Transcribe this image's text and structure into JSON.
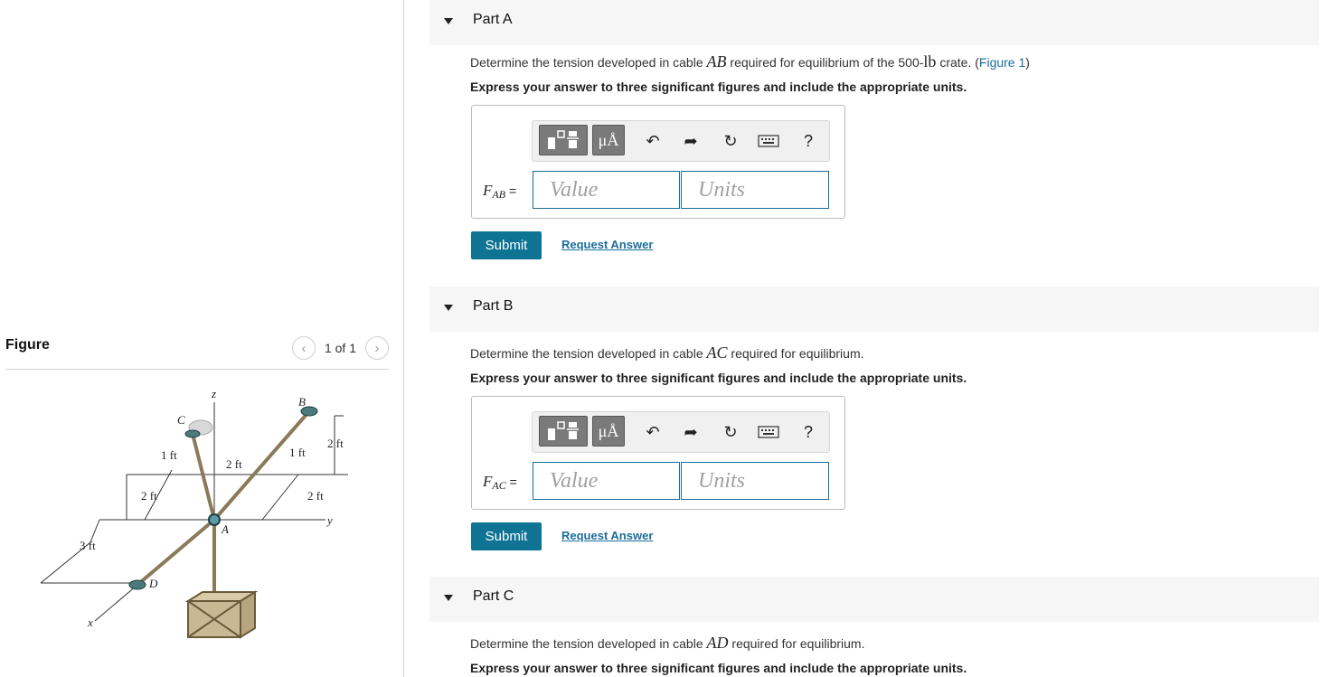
{
  "figure_panel": {
    "title": "Figure",
    "pager": {
      "prev_icon": "chevron-left-icon",
      "text": "1 of 1",
      "next_icon": "chevron-right-icon"
    },
    "diagram_labels": {
      "z": "z",
      "B": "B",
      "C": "C",
      "A": "A",
      "D": "D",
      "y": "y",
      "x": "x",
      "dim_1ft_left": "1 ft",
      "dim_2ft_mid": "2 ft",
      "dim_1ft_mid": "1 ft",
      "dim_2ft_right_top": "2 ft",
      "dim_2ft_left": "2 ft",
      "dim_2ft_right": "2 ft",
      "dim_3ft": "3 ft"
    }
  },
  "parts": [
    {
      "label": "Part A",
      "question_prefix": "Determine the tension developed in cable ",
      "cable": "AB",
      "question_mid": " required for equilibrium of the 500-",
      "unit_lb": "lb",
      "question_suffix": " crate. (",
      "figure_link": "Figure 1",
      "question_close": ")",
      "instruction": "Express your answer to three significant figures and include the appropriate units.",
      "answer": {
        "var": "F",
        "sub": "AB",
        "eq": " =",
        "value_placeholder": "Value",
        "units_placeholder": "Units"
      },
      "submit": "Submit",
      "request": "Request Answer"
    },
    {
      "label": "Part B",
      "question_prefix": "Determine the tension developed in cable ",
      "cable": "AC",
      "question_suffix": " required for equilibrium.",
      "instruction": "Express your answer to three significant figures and include the appropriate units.",
      "answer": {
        "var": "F",
        "sub": "AC",
        "eq": " =",
        "value_placeholder": "Value",
        "units_placeholder": "Units"
      },
      "submit": "Submit",
      "request": "Request Answer"
    },
    {
      "label": "Part C",
      "question_prefix": "Determine the tension developed in cable ",
      "cable": "AD",
      "question_suffix": " required for equilibrium.",
      "instruction": "Express your answer to three significant figures and include the appropriate units."
    }
  ],
  "toolbar": {
    "matrix_icon": "templates-icon",
    "units_label": "μÅ",
    "undo_icon": "undo-icon",
    "redo_icon": "redo-icon",
    "reset_icon": "reset-icon",
    "keyboard_icon": "keyboard-icon",
    "help_label": "?"
  },
  "colors": {
    "accent": "#0f7394",
    "link": "#1a6c9c",
    "part_header_bg": "#f6f6f6"
  }
}
